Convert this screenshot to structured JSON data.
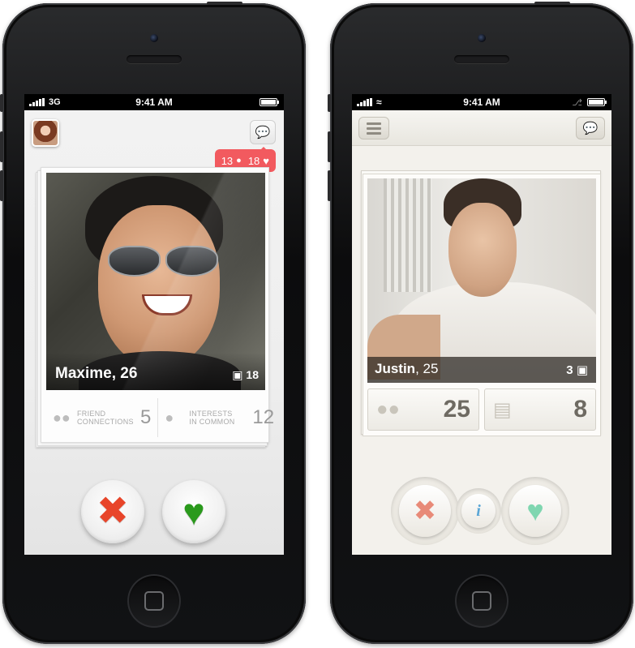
{
  "left_phone": {
    "status": {
      "carrier": "3G",
      "time": "9:41 AM"
    },
    "notification": {
      "messages": "13",
      "likes": "18"
    },
    "profile": {
      "name": "Maxime, 26",
      "photo_count": "18"
    },
    "stats": [
      {
        "label_line1": "FRIEND",
        "label_line2": "CONNECTIONS",
        "value": "5"
      },
      {
        "label_line1": "INTERESTS",
        "label_line2": "IN COMMON",
        "value": "12"
      }
    ],
    "icons": {
      "chat": "chat-bubble-icon",
      "camera": "camera-icon",
      "reject": "x-icon",
      "like": "heart-icon"
    },
    "colors": {
      "notification": "#f25a5f",
      "reject": "#e8452a",
      "like": "#2a9a1c"
    }
  },
  "right_phone": {
    "status": {
      "time": "9:41 AM"
    },
    "profile": {
      "first_name": "Justin",
      "age_text": ", 25",
      "photo_count": "3"
    },
    "stats": [
      {
        "icon": "friends-icon",
        "value": "25"
      },
      {
        "icon": "book-icon",
        "value": "8"
      }
    ],
    "icons": {
      "menu": "menu-icon",
      "chat": "chat-bubble-icon",
      "reject": "x-icon",
      "info": "info-icon",
      "like": "heart-icon"
    },
    "colors": {
      "reject": "#e88a78",
      "info": "#5aa6d6",
      "like": "#7fd6b0"
    }
  }
}
